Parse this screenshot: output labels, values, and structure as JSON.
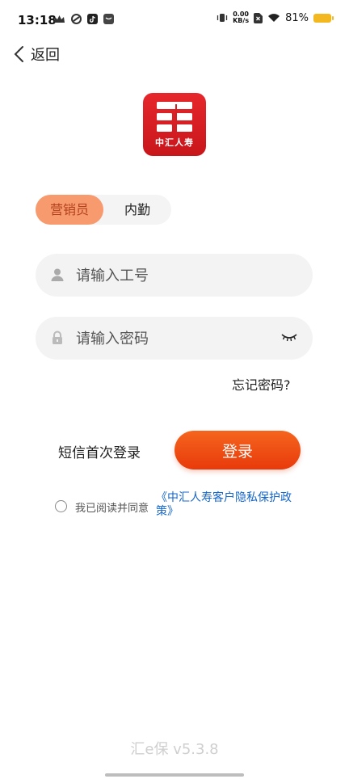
{
  "status_bar": {
    "time": "13:18",
    "net_speed_value": "0.00",
    "net_speed_unit": "KB/s",
    "battery": "81%"
  },
  "nav": {
    "back_label": "返回"
  },
  "logo": {
    "text": "中汇人寿"
  },
  "role_tabs": {
    "active": "营销员",
    "inactive": "内勤"
  },
  "form": {
    "employee_id_placeholder": "请输入工号",
    "password_placeholder": "请输入密码",
    "forgot_password": "忘记密码?"
  },
  "actions": {
    "sms_login": "短信首次登录",
    "login": "登录"
  },
  "agreement": {
    "prefix": "我已阅读并同意",
    "policy_link": "《中汇人寿客户隐私保护政策》"
  },
  "footer": {
    "version": "汇e保 v5.3.8"
  }
}
